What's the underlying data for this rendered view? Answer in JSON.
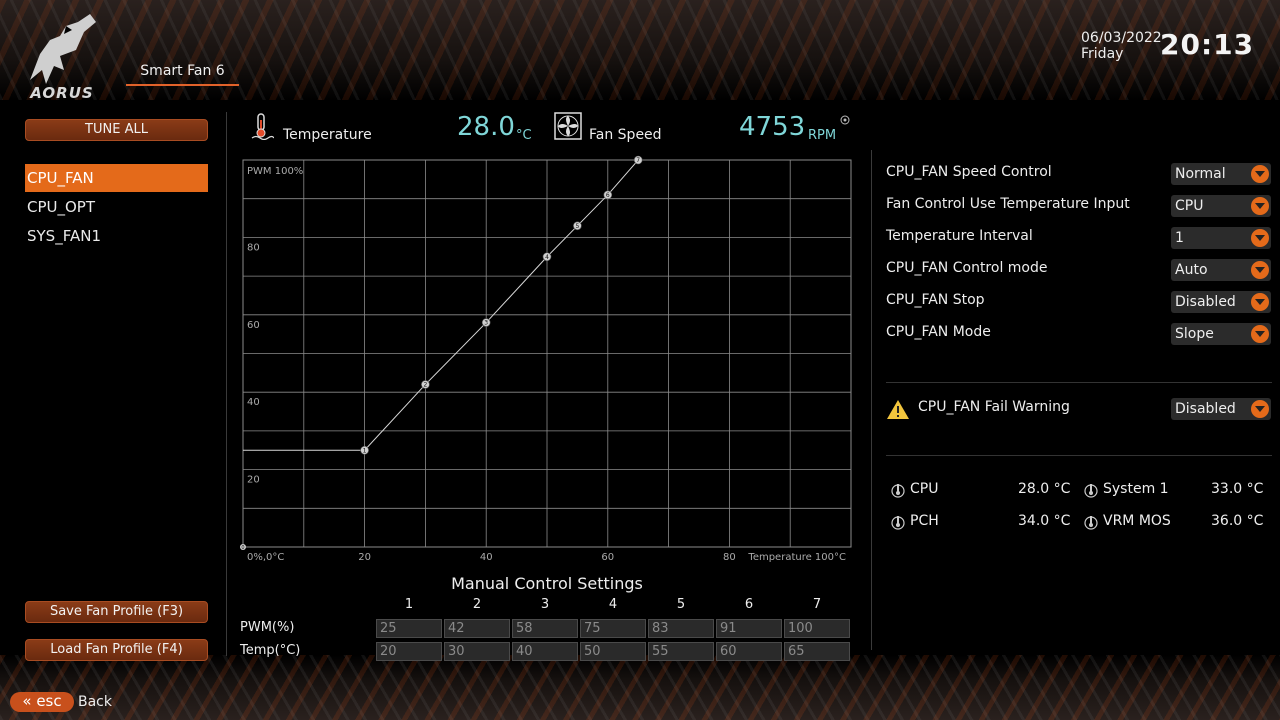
{
  "header": {
    "brand": "AORUS",
    "page_tab": "Smart Fan 6",
    "date": "06/03/2022",
    "weekday": "Friday",
    "time": "20:13"
  },
  "sidebar": {
    "tune_all": "TUNE ALL",
    "fans": [
      {
        "label": "CPU_FAN",
        "selected": true
      },
      {
        "label": "CPU_OPT",
        "selected": false
      },
      {
        "label": "SYS_FAN1",
        "selected": false
      }
    ],
    "save_profile": "Save Fan Profile (F3)",
    "load_profile": "Load Fan Profile (F4)"
  },
  "readouts": {
    "temperature_label": "Temperature",
    "temperature_value": "28.0",
    "temperature_unit": "°C",
    "fan_speed_label": "Fan Speed",
    "fan_speed_value": "4753",
    "fan_speed_unit": "RPM"
  },
  "chart_data": {
    "type": "line",
    "ylabel": "PWM 100%",
    "xlabel": "Temperature 100°C",
    "origin_label": "0%,0°C",
    "xlim": [
      0,
      100
    ],
    "ylim": [
      0,
      100
    ],
    "x_ticks": [
      20,
      40,
      60,
      80
    ],
    "y_ticks": [
      20,
      40,
      60,
      80
    ],
    "grid": true,
    "points": [
      {
        "id": "1",
        "x": 20,
        "y": 25
      },
      {
        "id": "2",
        "x": 30,
        "y": 42
      },
      {
        "id": "3",
        "x": 40,
        "y": 58
      },
      {
        "id": "4",
        "x": 50,
        "y": 75
      },
      {
        "id": "5",
        "x": 55,
        "y": 83
      },
      {
        "id": "6",
        "x": 60,
        "y": 91
      },
      {
        "id": "7",
        "x": 65,
        "y": 100
      }
    ],
    "start_point": {
      "x": 0,
      "y": 25
    },
    "origin_point": "0"
  },
  "manual": {
    "title": "Manual Control Settings",
    "columns": [
      "1",
      "2",
      "3",
      "4",
      "5",
      "6",
      "7"
    ],
    "pwm_label": "PWM(%)",
    "temp_label": "Temp(°C)",
    "pwm": [
      "25",
      "42",
      "58",
      "75",
      "83",
      "91",
      "100"
    ],
    "temp": [
      "20",
      "30",
      "40",
      "50",
      "55",
      "60",
      "65"
    ]
  },
  "settings": [
    {
      "label": "CPU_FAN Speed Control",
      "value": "Normal"
    },
    {
      "label": "Fan Control Use Temperature Input",
      "value": "CPU"
    },
    {
      "label": "Temperature Interval",
      "value": "1"
    },
    {
      "label": "CPU_FAN Control mode",
      "value": "Auto"
    },
    {
      "label": "CPU_FAN Stop",
      "value": "Disabled"
    },
    {
      "label": "CPU_FAN Mode",
      "value": "Slope"
    }
  ],
  "fail_warning": {
    "label": "CPU_FAN Fail Warning",
    "value": "Disabled"
  },
  "sensors": [
    {
      "label": "CPU",
      "value": "28.0 °C"
    },
    {
      "label": "System 1",
      "value": "33.0 °C"
    },
    {
      "label": "PCH",
      "value": "34.0 °C"
    },
    {
      "label": "VRM MOS",
      "value": "36.0 °C"
    }
  ],
  "footer": {
    "esc": "esc",
    "back": "Back"
  },
  "colors": {
    "accent": "#e46a1a",
    "readout": "#7fd6d8",
    "grid": "#8c8c8c"
  }
}
